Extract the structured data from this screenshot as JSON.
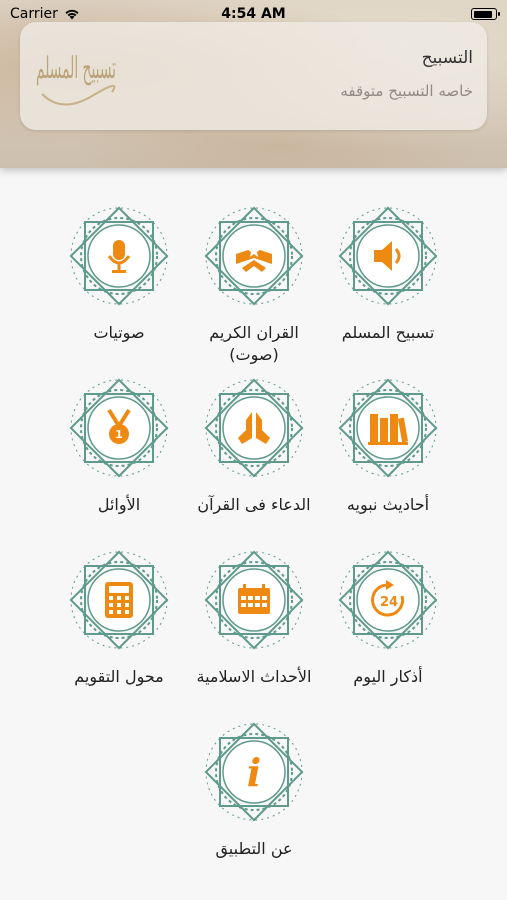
{
  "status_bar": {
    "carrier": "Carrier",
    "time": "4:54 AM"
  },
  "notification": {
    "title": "التسبيح",
    "subtitle": "خاصه التسبيح متوقفه",
    "logo_text": "تسبيح المسلم"
  },
  "colors": {
    "accent": "#ee8a12",
    "badge_ring": "#5f9a8c",
    "badge_inner": "#ffffff"
  },
  "menu": [
    {
      "label": "تسبيح المسلم",
      "icon": "speaker-icon"
    },
    {
      "label": "القران الكريم (صوت)",
      "icon": "quran-icon"
    },
    {
      "label": "صوتيات",
      "icon": "microphone-icon"
    },
    {
      "label": "أحاديث نبويه",
      "icon": "books-icon"
    },
    {
      "label": "الدعاء فى القرآن",
      "icon": "praying-hands-icon"
    },
    {
      "label": "الأوائل",
      "icon": "medal-icon"
    },
    {
      "label": "أذكار اليوم",
      "icon": "24-hours-icon",
      "icon_text": "24"
    },
    {
      "label": "الأحداث الاسلامية",
      "icon": "calendar-icon"
    },
    {
      "label": "محول التقويم",
      "icon": "calculator-icon"
    },
    {
      "label": "عن التطبيق",
      "icon": "info-icon",
      "icon_text": "i"
    }
  ]
}
